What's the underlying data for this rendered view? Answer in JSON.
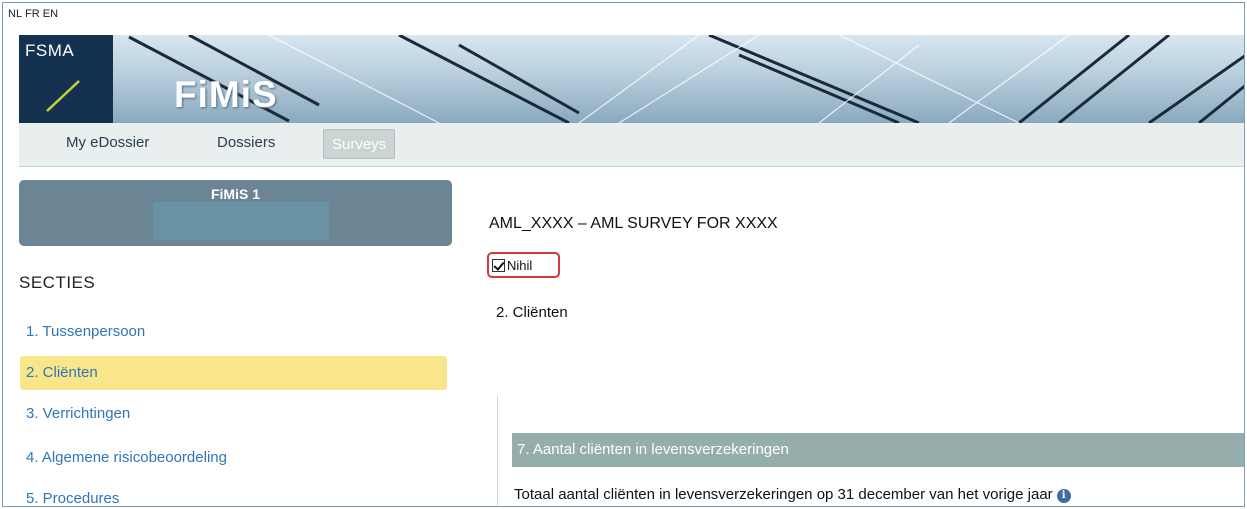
{
  "languages": [
    "NL",
    "FR",
    "EN"
  ],
  "brand": {
    "org": "FSMA",
    "app": "FiMiS"
  },
  "nav": [
    {
      "label": "My eDossier",
      "active": false
    },
    {
      "label": "Dossiers",
      "active": false
    },
    {
      "label": "Surveys",
      "active": true
    }
  ],
  "sidebar": {
    "card_title": "FiMiS 1",
    "heading": "SECTIES",
    "items": [
      {
        "label": "1. Tussenpersoon",
        "active": false
      },
      {
        "label": "2. Cliënten",
        "active": true
      },
      {
        "label": "3. Verrichtingen",
        "active": false
      },
      {
        "label": "4. Algemene risicobeoordeling",
        "active": false
      },
      {
        "label": "5. Procedures",
        "active": false
      }
    ]
  },
  "main": {
    "survey_title": "AML_XXXX – AML SURVEY FOR XXXX",
    "nihil_label": "Nihil",
    "nihil_checked": true,
    "section_name": "2. Cliënten",
    "question_header": "7. Aantal cliënten in levensverzekeringen",
    "question_text": "Totaal aantal cliënten in levensverzekeringen op 31 december van het vorige jaar"
  },
  "colors": {
    "logo_bg": "#14324f",
    "nav_bg": "#e9efee",
    "sidebar_card": "#6c8594",
    "active_section": "#fae68a",
    "link": "#2f76b8",
    "question_header_bg": "#95aeab",
    "nihil_highlight": "#d43a3a"
  }
}
